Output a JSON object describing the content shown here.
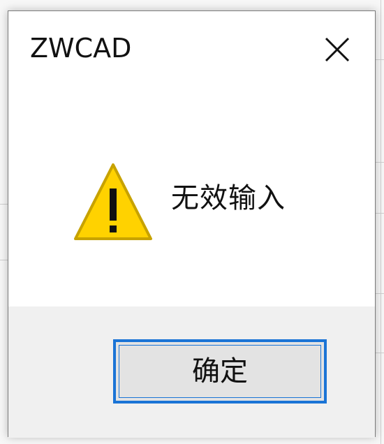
{
  "dialog": {
    "title": "ZWCAD",
    "message": "无效输入",
    "ok_label": "确定",
    "close_icon": "close-icon",
    "warning_icon": "warning-icon"
  },
  "colors": {
    "accent": "#1a74d6",
    "warning_fill": "#ffd200",
    "warning_stroke": "#c7a200"
  }
}
